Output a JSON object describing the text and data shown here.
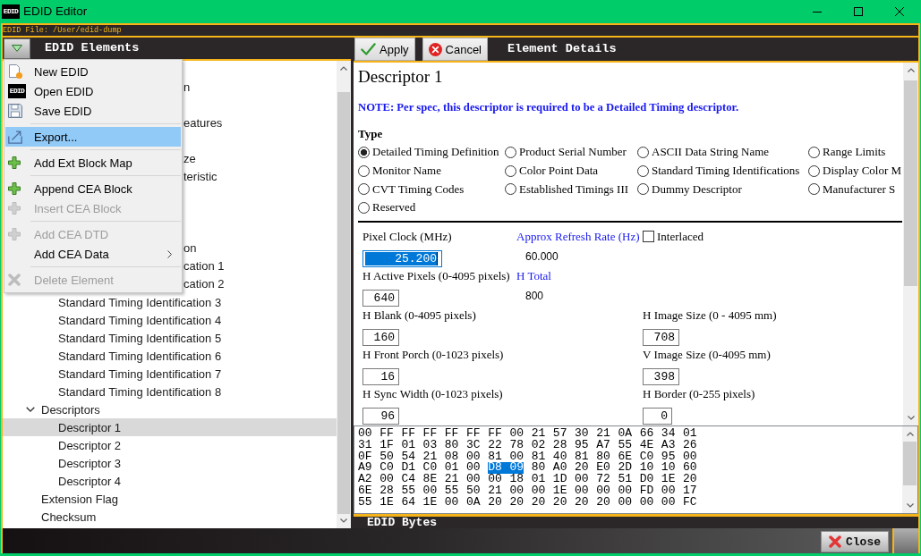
{
  "window": {
    "logo_text": "EDID",
    "title": "EDID Editor"
  },
  "file_bar": {
    "text": "EDID File: /User/edid-dump"
  },
  "elements_panel": {
    "title": "EDID Elements",
    "menu": {
      "items": [
        {
          "kind": "item",
          "label": "New EDID",
          "selected": false,
          "disabled": false
        },
        {
          "kind": "item",
          "label": "Open EDID",
          "icon_text": "EDID",
          "selected": false,
          "disabled": false
        },
        {
          "kind": "item",
          "label": "Save EDID",
          "selected": false,
          "disabled": false
        },
        {
          "kind": "separator"
        },
        {
          "kind": "item",
          "label": "Export...",
          "selected": true,
          "disabled": false
        },
        {
          "kind": "separator"
        },
        {
          "kind": "item",
          "label": "Add Ext Block Map",
          "selected": false,
          "disabled": false
        },
        {
          "kind": "separator"
        },
        {
          "kind": "item",
          "label": "Append CEA Block",
          "selected": false,
          "disabled": false
        },
        {
          "kind": "item",
          "label": "Insert CEA Block",
          "selected": false,
          "disabled": true
        },
        {
          "kind": "separator"
        },
        {
          "kind": "item",
          "label": "Add CEA DTD",
          "selected": false,
          "disabled": true
        },
        {
          "kind": "submenu",
          "label": "Add CEA Data",
          "selected": false,
          "disabled": false
        },
        {
          "kind": "separator"
        },
        {
          "kind": "item",
          "label": "Delete Element",
          "selected": false,
          "disabled": true
        }
      ]
    },
    "tree": {
      "items": [
        {
          "label": "n",
          "selected": false
        },
        {
          "label": "eatures",
          "selected": false
        },
        {
          "label": "ze",
          "selected": false
        },
        {
          "label": "teristic",
          "selected": false
        },
        {
          "label": "on",
          "selected": false,
          "children": [
            {
              "label": "cation 1",
              "selected": false
            },
            {
              "label": "cation 2",
              "selected": false
            },
            {
              "label": "Standard Timing Identification 3",
              "selected": false
            },
            {
              "label": "Standard Timing Identification 4",
              "selected": false
            },
            {
              "label": "Standard Timing Identification 5",
              "selected": false
            },
            {
              "label": "Standard Timing Identification 6",
              "selected": false
            },
            {
              "label": "Standard Timing Identification 7",
              "selected": false
            },
            {
              "label": "Standard Timing Identification 8",
              "selected": false
            }
          ]
        },
        {
          "label": "Descriptors",
          "selected": false,
          "expanded": true,
          "children": [
            {
              "label": "Descriptor 1",
              "selected": true
            },
            {
              "label": "Descriptor 2",
              "selected": false
            },
            {
              "label": "Descriptor 3",
              "selected": false
            },
            {
              "label": "Descriptor 4",
              "selected": false
            }
          ]
        },
        {
          "label": "Extension Flag",
          "selected": false
        },
        {
          "label": "Checksum",
          "selected": false
        }
      ]
    }
  },
  "details_panel": {
    "buttons": [
      {
        "label": "Apply"
      },
      {
        "label": "Cancel"
      }
    ],
    "title": "Element Details",
    "heading": "Descriptor 1",
    "note": "NOTE: Per spec, this descriptor is required to be a Detailed Timing descriptor.",
    "type_label": "Type",
    "type_options": [
      {
        "label": "Detailed Timing Definition",
        "selected": true
      },
      {
        "label": "Product Serial Number",
        "selected": false
      },
      {
        "label": "ASCII Data String Name",
        "selected": false
      },
      {
        "label": "Range Limits",
        "selected": false
      },
      {
        "label": "Monitor Name",
        "selected": false
      },
      {
        "label": "Color Point Data",
        "selected": false
      },
      {
        "label": "Standard Timing Identifications",
        "selected": false
      },
      {
        "label": "Display Color M",
        "selected": false
      },
      {
        "label": "CVT Timing Codes",
        "selected": false
      },
      {
        "label": "Established Timings III",
        "selected": false
      },
      {
        "label": "Dummy Descriptor",
        "selected": false
      },
      {
        "label": "Manufacturer S",
        "selected": false
      },
      {
        "label": "Reserved",
        "selected": false
      }
    ],
    "timing_rows": [
      {
        "left": {
          "kind": "input",
          "label": "Pixel Clock (MHz)",
          "value": "25.200",
          "focused": true
        },
        "middle": {
          "kind": "readout",
          "label": "Approx Refresh Rate (Hz)",
          "value": "60.000"
        },
        "right": {
          "kind": "checkbox",
          "label": "Interlaced",
          "checked": false
        }
      },
      {
        "left": {
          "kind": "input",
          "label": "H Active Pixels (0-4095 pixels)",
          "value": "640",
          "focused": false
        },
        "middle": {
          "kind": "readout",
          "label": "H Total",
          "value": "800"
        }
      },
      {
        "left": {
          "kind": "input",
          "label": "H Blank (0-4095 pixels)",
          "value": "160",
          "focused": false
        },
        "right": {
          "kind": "input",
          "label": "H Image Size (0 - 4095 mm)",
          "value": "708",
          "focused": false
        }
      },
      {
        "left": {
          "kind": "input",
          "label": "H Front Porch (0-1023 pixels)",
          "value": "16",
          "focused": false
        },
        "right": {
          "kind": "input",
          "label": "V Image Size (0-4095 mm)",
          "value": "398",
          "focused": false
        }
      },
      {
        "left": {
          "kind": "input",
          "label": "H Sync Width (0-1023 pixels)",
          "value": "96",
          "focused": false
        },
        "right": {
          "kind": "input",
          "label": "H Border (0-255 pixels)",
          "value": "0",
          "focused": false
        }
      }
    ]
  },
  "bytes_panel": {
    "rows": [
      {
        "segments": [
          {
            "text": "00 FF FF FF FF FF FF 00 21 57 30 21 0A 66 34 01",
            "selected": false
          }
        ]
      },
      {
        "segments": [
          {
            "text": "31 1F 01 03 80 3C 22 78 02 28 95 A7 55 4E A3 26",
            "selected": false
          }
        ]
      },
      {
        "segments": [
          {
            "text": "0F 50 54 21 08 00 81 00 81 40 81 80 6E C0 95 00",
            "selected": false
          }
        ]
      },
      {
        "segments": [
          {
            "text": "A9 C0 D1 C0 01 00",
            "selected": false
          },
          {
            "text": "D8 09",
            "selected": true
          },
          {
            "text": "80 A0 20 E0 2D 10 10 60",
            "selected": false
          }
        ]
      },
      {
        "segments": [
          {
            "text": "A2 00 C4 8E 21 00 00 18 01 1D 00 72 51 D0 1E 20",
            "selected": false
          }
        ]
      },
      {
        "segments": [
          {
            "text": "6E 28 55 00 55 50 21 00 00 1E 00 00 00 FD 00 17",
            "selected": false
          }
        ]
      },
      {
        "segments": [
          {
            "text": "55 1E 64 1E 00 0A 20 20 20 20 20 20 00 00 00 FC",
            "selected": false
          }
        ]
      }
    ],
    "title": "EDID Bytes"
  },
  "footer": {
    "close_button": {
      "label": "Close"
    }
  }
}
